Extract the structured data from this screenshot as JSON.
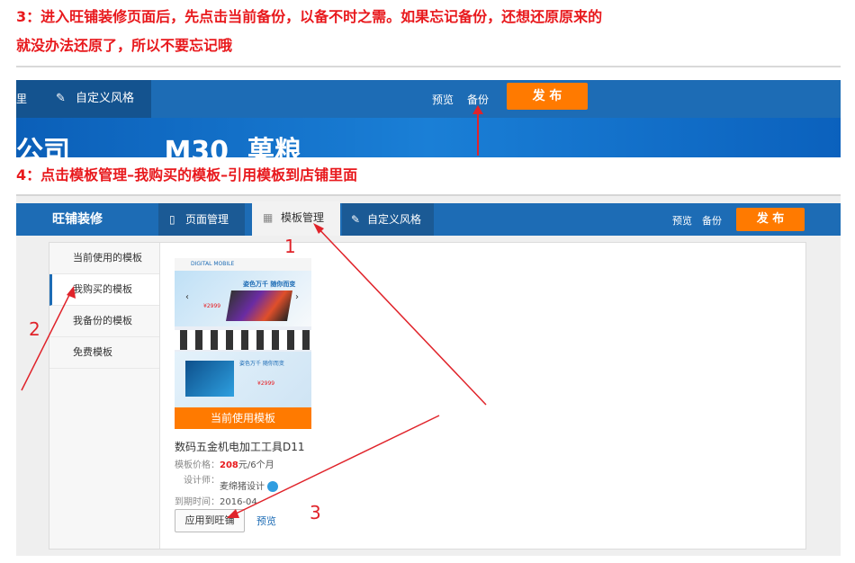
{
  "step3": {
    "line1": "3：进入旺铺装修页面后，先点击当前备份，以备不时之需。如果忘记备份，还想还原原来的",
    "line2": "就没办法还原了，所以不要忘记哦"
  },
  "shot1": {
    "left_tab_partial": "里",
    "custom_style_tab": "自定义风格",
    "preview": "预览",
    "backup": "备份",
    "publish": "发 布",
    "banner_partial": "公司          M30  菓粮"
  },
  "step4": {
    "text": "4：点击模板管理–我购买的模板–引用模板到店铺里面"
  },
  "editor": {
    "brand": "旺铺装修",
    "tabs": [
      "页面管理",
      "模板管理",
      "自定义风格"
    ],
    "preview": "预览",
    "backup": "备份",
    "publish": "发 布",
    "sidebar": [
      "当前使用的模板",
      "我购买的模板",
      "我备份的模板",
      "免费模板"
    ],
    "template": {
      "banner_label": "当前使用模板",
      "thumb_brand": "DIGITAL MOBILE",
      "thumb_tagline": "姿色万千 随你而变",
      "thumb_price1": "¥2999",
      "thumb_price2": "¥2999",
      "name": "数码五金机电加工工具D11",
      "price_label": "模板价格：",
      "price_value": "208",
      "price_unit": "元/6个月",
      "designer_label": "设计师：",
      "designer_value": "麦绵猪设计",
      "expire_label": "到期时间：",
      "expire_value": "2016-04",
      "apply_button": "应用到旺铺",
      "preview_link": "预览"
    }
  },
  "annotations": [
    "1",
    "2",
    "3"
  ],
  "colors": {
    "red": "#e8191d",
    "blue": "#1d6cb5",
    "orange": "#ff7a00"
  }
}
